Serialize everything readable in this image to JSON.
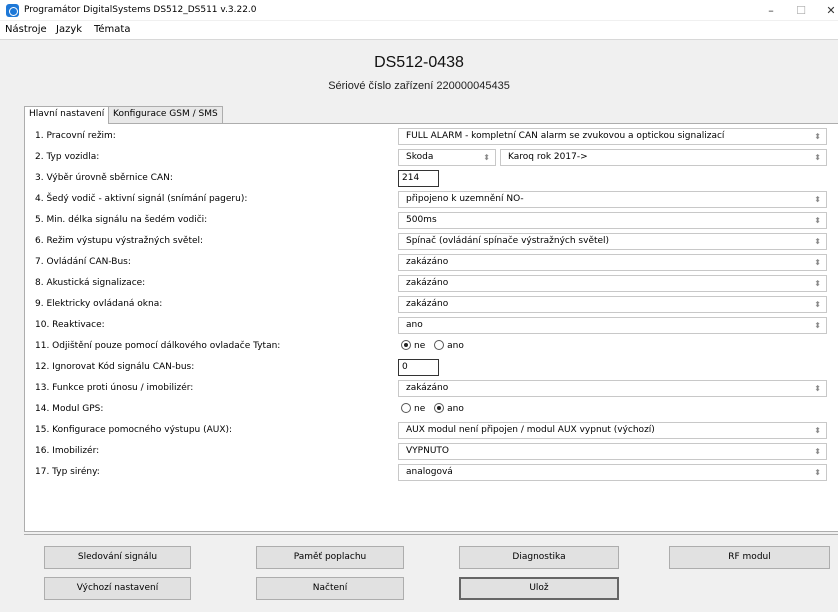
{
  "window": {
    "title": "Programátor DigitalSystems  DS512_DS511 v.3.22.0",
    "minimize": "–",
    "maximize": "☐",
    "close": "✕"
  },
  "menu": [
    "Nástroje",
    "Jazyk",
    "Témata"
  ],
  "header": {
    "device_name": "DS512-0438",
    "serial": "Sériové číslo zařízení 220000045435"
  },
  "tabs": [
    {
      "label": "Hlavní nastavení",
      "active": true
    },
    {
      "label": "Konfigurace GSM / SMS",
      "active": false
    }
  ],
  "settings": {
    "r1": {
      "label": "1. Pracovní režim:",
      "value": "FULL ALARM - kompletní CAN alarm se zvukovou a optickou signalizací"
    },
    "r2": {
      "label": "2. Typ vozidla:",
      "make": "Skoda",
      "model": "Karoq  rok 2017->"
    },
    "r3": {
      "label": "3. Výběr úrovně sběrnice CAN:",
      "value": "214"
    },
    "r4": {
      "label": "4. Šedý vodič - aktivní signál (snímání pageru):",
      "value": "připojeno k uzemnění NO-"
    },
    "r5": {
      "label": "5. Min. délka signálu na šedém vodiči:",
      "value": "500ms"
    },
    "r6": {
      "label": "6. Režim výstupu výstražných světel:",
      "value": "Spínač (ovládání spínače výstražných světel)"
    },
    "r7": {
      "label": "7. Ovládání CAN-Bus:",
      "value": "zakázáno"
    },
    "r8": {
      "label": "8. Akustická signalizace:",
      "value": "zakázáno"
    },
    "r9": {
      "label": "9. Elektricky ovládaná okna:",
      "value": "zakázáno"
    },
    "r10": {
      "label": "10. Reaktivace:",
      "value": "ano"
    },
    "r11": {
      "label": "11. Odjištění pouze pomocí dálkového ovladače Tytan:",
      "opt1": "ne",
      "opt2": "ano",
      "selected": "ne"
    },
    "r12": {
      "label": "12. Ignorovat Kód signálu CAN-bus:",
      "value": "0"
    },
    "r13": {
      "label": "13. Funkce proti únosu / imobilizér:",
      "value": "zakázáno"
    },
    "r14": {
      "label": "14. Modul GPS:",
      "opt1": "ne",
      "opt2": "ano",
      "selected": "ano"
    },
    "r15": {
      "label": "15. Konfigurace pomocného výstupu (AUX):",
      "value": "AUX modul není připojen / modul AUX vypnut (výchozí)"
    },
    "r16": {
      "label": "16. Imobilizér:",
      "value": "VYPNUTO"
    },
    "r17": {
      "label": "17. Typ sirény:",
      "value": "analogová"
    }
  },
  "buttons": {
    "signal_monitor": "Sledování signálu",
    "alarm_memory": "Paměť poplachu",
    "diagnostics": "Diagnostika",
    "rf_module": "RF modul",
    "defaults": "Výchozí nastavení",
    "load": "Načtení",
    "save": "Ulož"
  },
  "arrow_glyph": "⬍"
}
